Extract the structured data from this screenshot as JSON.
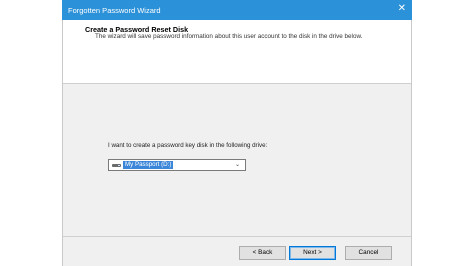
{
  "window": {
    "title": "Forgotten Password Wizard",
    "close_glyph": "✕"
  },
  "header": {
    "heading": "Create a Password Reset Disk",
    "description": "The wizard will save password information about this user account to the disk in the drive below."
  },
  "form": {
    "prompt": "I want to create a password key disk in the following drive:",
    "drive_select": {
      "selected": "My Passport (D:)",
      "icon": "drive-icon",
      "chevron": "⌄"
    }
  },
  "buttons": {
    "back": "< Back",
    "next": "Next >",
    "cancel": "Cancel"
  }
}
